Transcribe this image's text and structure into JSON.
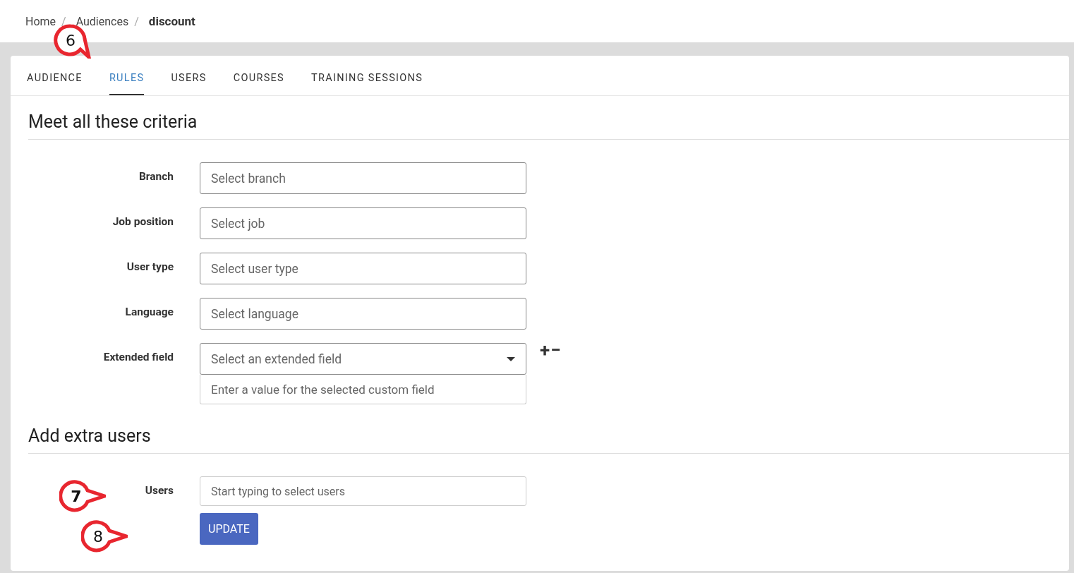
{
  "breadcrumb": [
    {
      "label": "Home",
      "current": false
    },
    {
      "label": "Audiences",
      "current": false
    },
    {
      "label": "discount",
      "current": true
    }
  ],
  "breadcrumb_separator": "/",
  "tabs": [
    {
      "label": "AUDIENCE",
      "selected": false
    },
    {
      "label": "RULES",
      "selected": true,
      "callout": "6"
    },
    {
      "label": "USERS",
      "selected": false
    },
    {
      "label": "COURSES",
      "selected": false
    },
    {
      "label": "TRAINING SESSIONS",
      "selected": false
    }
  ],
  "criteria": {
    "heading": "Meet all these criteria",
    "fields": [
      {
        "kind": "input",
        "label": "Branch",
        "placeholder": "Select branch"
      },
      {
        "kind": "input",
        "label": "Job position",
        "placeholder": "Select job"
      },
      {
        "kind": "input",
        "label": "User type",
        "placeholder": "Select user type"
      },
      {
        "kind": "input",
        "label": "Language",
        "placeholder": "Select language"
      },
      {
        "kind": "extended",
        "label": "Extended field",
        "placeholder": "Select an extended field",
        "value_placeholder": "Enter a value for the selected custom field",
        "add": "+",
        "remove": "−"
      }
    ]
  },
  "extra_users": {
    "heading": "Add extra users",
    "label": "Users",
    "placeholder": "Start typing to select users",
    "callout": "7"
  },
  "update_button": {
    "label": "UPDATE",
    "callout": "8"
  }
}
